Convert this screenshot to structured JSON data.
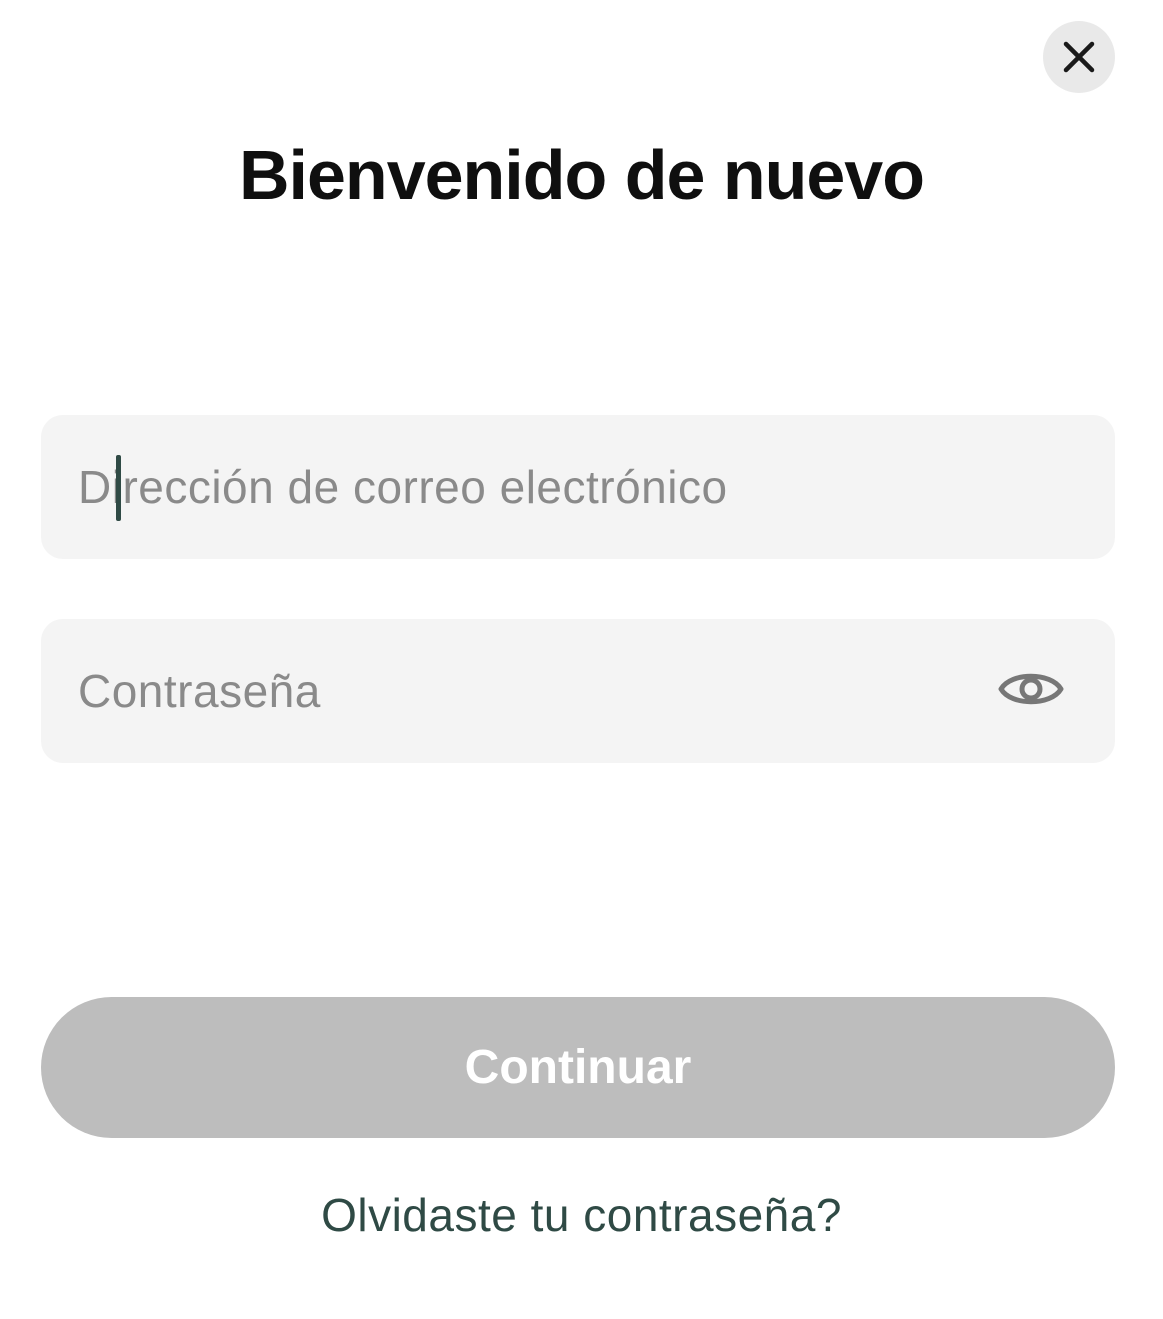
{
  "dialog": {
    "title": "Bienvenido de nuevo",
    "close_icon": "close-icon"
  },
  "form": {
    "email": {
      "placeholder": "Dirección de correo electrónico",
      "value": ""
    },
    "password": {
      "placeholder": "Contraseña",
      "value": "",
      "toggle_icon": "eye-icon"
    },
    "continue_label": "Continuar",
    "forgot_label": "Olvidaste tu contraseña?"
  },
  "colors": {
    "accent_text": "#2f4a45",
    "button_disabled": "#bdbdbd",
    "field_background": "#f4f4f4"
  }
}
